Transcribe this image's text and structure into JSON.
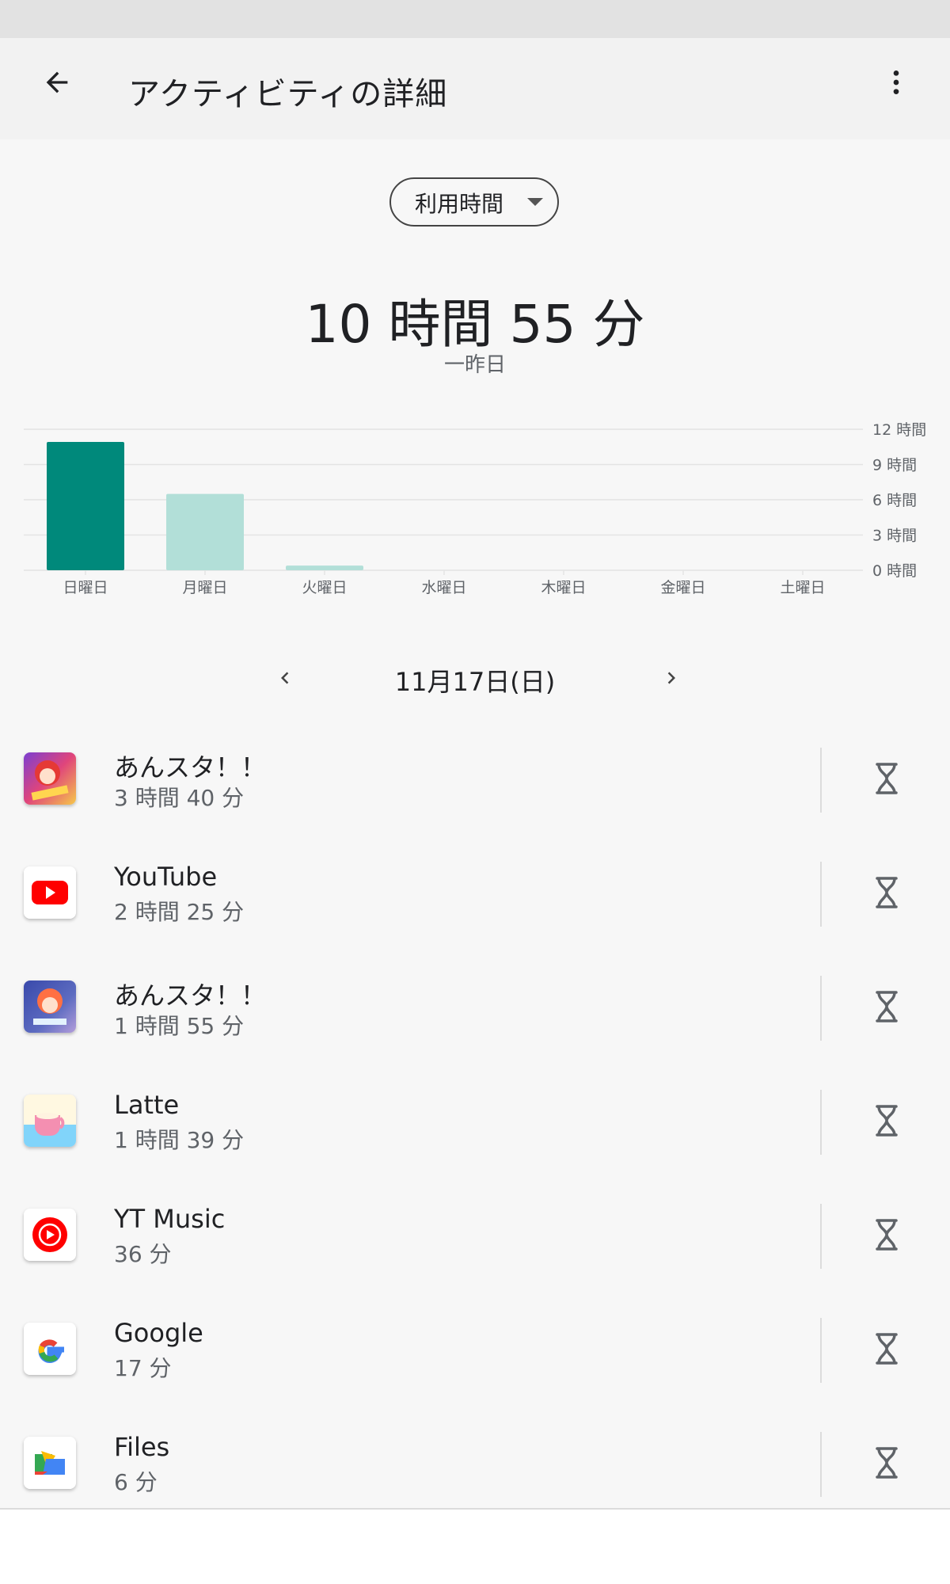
{
  "header": {
    "title": "アクティビティの詳細"
  },
  "metric_selector": {
    "label": "利用時間"
  },
  "summary": {
    "total": "10 時間 55 分",
    "day": "一昨日"
  },
  "chart_data": {
    "type": "bar",
    "categories": [
      "日曜日",
      "月曜日",
      "火曜日",
      "水曜日",
      "木曜日",
      "金曜日",
      "土曜日"
    ],
    "values": [
      10.92,
      6.5,
      0.4,
      0,
      0,
      0,
      0
    ],
    "y_ticks": [
      "0 時間",
      "3 時間",
      "6 時間",
      "9 時間",
      "12 時間"
    ],
    "y_tick_values": [
      0,
      3,
      6,
      9,
      12
    ],
    "ylim": [
      0,
      12
    ],
    "selected_index": 0,
    "colors": {
      "selected": "#00897b",
      "unselected": "#b2dfd8",
      "grid": "#e4e4e4",
      "tick": "#5f6368"
    },
    "grid": true
  },
  "date_nav": {
    "label": "11月17日(日)"
  },
  "apps": [
    {
      "name": "あんスタ！！",
      "time": "3 時間 40 分",
      "icon": "ensemble-stars-music-icon"
    },
    {
      "name": "YouTube",
      "time": "2 時間 25 分",
      "icon": "youtube-icon"
    },
    {
      "name": "あんスタ！！",
      "time": "1 時間 55 分",
      "icon": "ensemble-stars-basic-icon"
    },
    {
      "name": "Latte",
      "time": "1 時間 39 分",
      "icon": "latte-icon"
    },
    {
      "name": "YT Music",
      "time": "36 分",
      "icon": "yt-music-icon"
    },
    {
      "name": "Google",
      "time": "17 分",
      "icon": "google-icon"
    },
    {
      "name": "Files",
      "time": "6 分",
      "icon": "files-icon"
    }
  ]
}
